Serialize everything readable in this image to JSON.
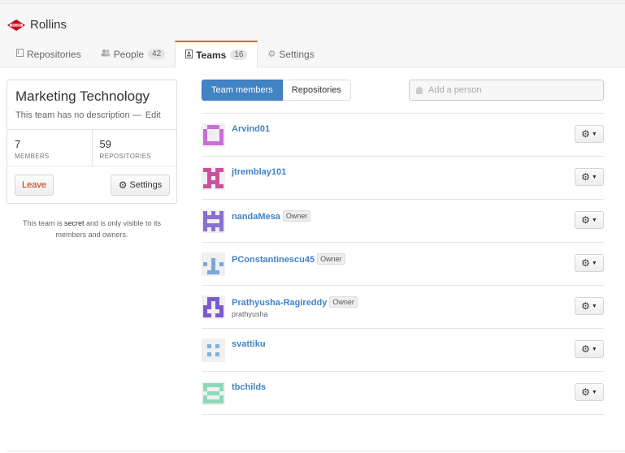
{
  "org": {
    "name": "Rollins",
    "logo_text": "ROLLINS",
    "brand_color": "#d0021b"
  },
  "tabs": [
    {
      "label": "Repositories",
      "icon": "repo-icon",
      "active": false
    },
    {
      "label": "People",
      "icon": "people-icon",
      "count": "42",
      "active": false
    },
    {
      "label": "Teams",
      "icon": "team-icon",
      "count": "16",
      "active": true
    },
    {
      "label": "Settings",
      "icon": "gear-icon",
      "active": false
    }
  ],
  "team": {
    "name": "Marketing Technology",
    "description": "This team has no description",
    "sep": "—",
    "edit_label": "Edit",
    "members_count": "7",
    "members_label": "MEMBERS",
    "repos_count": "59",
    "repos_label": "REPOSITORIES",
    "leave_label": "Leave",
    "settings_label": "Settings"
  },
  "secret_note": {
    "pre": "This team is ",
    "strong": "secret",
    "post": " and is only visible to its members and owners."
  },
  "view_tabs": {
    "members_label": "Team members",
    "repos_label": "Repositories"
  },
  "add_person": {
    "placeholder": "Add a person"
  },
  "owner_badge": "Owner",
  "colors": {
    "accent": "#4183c4",
    "active_tab_border": "#d26911",
    "danger": "#bd2c00"
  },
  "members": [
    {
      "username": "Arvind01",
      "owner": false,
      "fullname": "",
      "avatar_color": "#c86ed6"
    },
    {
      "username": "jtremblay101",
      "owner": false,
      "fullname": "",
      "avatar_color": "#c8529b"
    },
    {
      "username": "nandaMesa",
      "owner": true,
      "fullname": "",
      "avatar_color": "#8a6fd3"
    },
    {
      "username": "PConstantinescu45",
      "owner": true,
      "fullname": "",
      "avatar_color": "#7aa7d6"
    },
    {
      "username": "Prathyusha-Ragireddy",
      "owner": true,
      "fullname": "prathyusha",
      "avatar_color": "#7b5ad1"
    },
    {
      "username": "svattiku",
      "owner": false,
      "fullname": "",
      "avatar_color": "#7ab3e0"
    },
    {
      "username": "tbchilds",
      "owner": false,
      "fullname": "",
      "avatar_color": "#8cd9b8"
    }
  ]
}
